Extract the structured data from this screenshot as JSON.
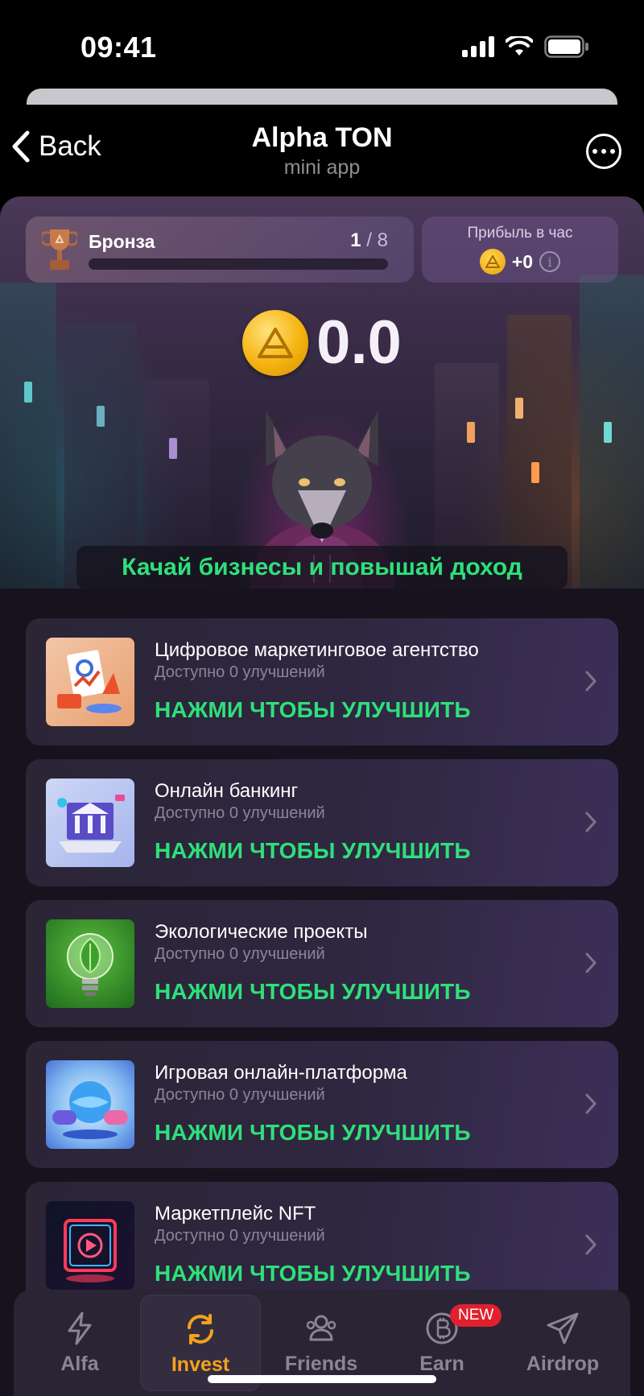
{
  "status_bar": {
    "time": "09:41"
  },
  "header": {
    "back_label": "Back",
    "title": "Alpha TON",
    "subtitle": "mini app"
  },
  "rank": {
    "name": "Бронза",
    "level": "1",
    "level_separator": "/",
    "level_max": "8",
    "progress_fraction": 0.0
  },
  "profit": {
    "label": "Прибыль в час",
    "value": "+0"
  },
  "balance": {
    "value": "0.0"
  },
  "hero_banner": "Качай бизнесы и повышай доход",
  "businesses": [
    {
      "title": "Цифровое маркетинговое агентство",
      "subtitle": "Доступно 0 улучшений",
      "cta": "НАЖМИ ЧТОБЫ УЛУЧШИТЬ"
    },
    {
      "title": "Онлайн банкинг",
      "subtitle": "Доступно 0 улучшений",
      "cta": "НАЖМИ ЧТОБЫ УЛУЧШИТЬ"
    },
    {
      "title": "Экологические проекты",
      "subtitle": "Доступно 0 улучшений",
      "cta": "НАЖМИ ЧТОБЫ УЛУЧШИТЬ"
    },
    {
      "title": "Игровая онлайн-платформа",
      "subtitle": "Доступно 0 улучшений",
      "cta": "НАЖМИ ЧТОБЫ УЛУЧШИТЬ"
    },
    {
      "title": "Маркетплейс NFT",
      "subtitle": "Доступно 0 улучшений",
      "cta": "НАЖМИ ЧТОБЫ УЛУЧШИТЬ"
    }
  ],
  "tabs": [
    {
      "label": "Alfa",
      "icon": "bolt-icon",
      "active": false
    },
    {
      "label": "Invest",
      "icon": "refresh-icon",
      "active": true
    },
    {
      "label": "Friends",
      "icon": "users-icon",
      "active": false
    },
    {
      "label": "Earn",
      "icon": "bitcoin-icon",
      "active": false,
      "badge": "NEW"
    },
    {
      "label": "Airdrop",
      "icon": "paper-plane-icon",
      "active": false
    }
  ],
  "colors": {
    "accent_green": "#2ee07a",
    "accent_orange": "#f4a21c",
    "badge_red": "#e0202e",
    "coin_gold": "#f5b310"
  }
}
